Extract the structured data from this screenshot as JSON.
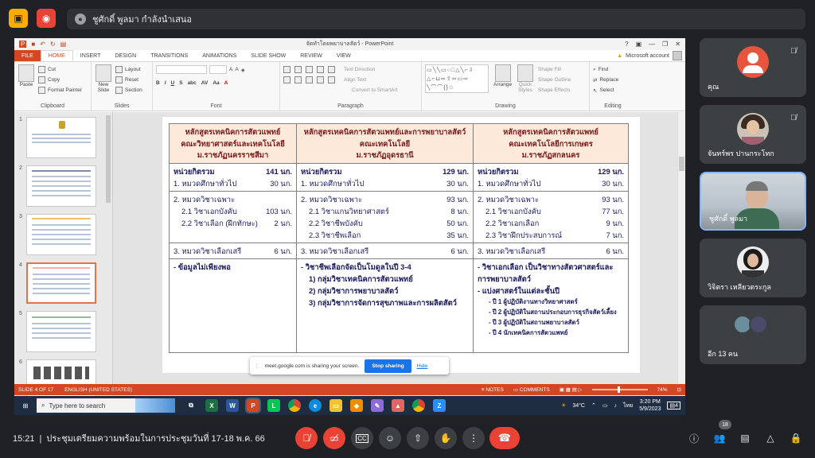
{
  "meet": {
    "presenter_name": "ชูศักดิ์ พูลมา กำลังนำเสนอ",
    "time": "15:21",
    "meeting_title": "ประชุมเตรียมความพร้อมในการประชุมวันที่ 17-18 พ.ค. 66",
    "participant_count": "18",
    "share_notice": "meet.google.com is sharing your screen.",
    "stop_sharing": "Stop sharing",
    "hide": "Hide",
    "participants": [
      {
        "name": "คุณ",
        "muted": true
      },
      {
        "name": "จันทร์พร ปานกระโทก",
        "muted": true
      },
      {
        "name": "ชูศักดิ์ พูลมา",
        "muted": false
      },
      {
        "name": "วิจิตรา เหลียวตระกูล",
        "muted": false
      },
      {
        "name": "อีก 13 คน",
        "muted": false
      }
    ],
    "colors": {
      "accent_red": "#ea4335",
      "tile_bg": "#3c4043",
      "blue": "#1a73e8"
    }
  },
  "ppt": {
    "window_title": "จัดทำโดยพยาบาลสัตว์ - PowerPoint",
    "tabs": [
      "FILE",
      "HOME",
      "INSERT",
      "DESIGN",
      "TRANSITIONS",
      "ANIMATIONS",
      "SLIDE SHOW",
      "REVIEW",
      "VIEW"
    ],
    "account": "Microsoft account",
    "ribbon": {
      "paste": "Paste",
      "cut": "Cut",
      "copy": "Copy",
      "format_painter": "Format Painter",
      "clipboard": "Clipboard",
      "new_slide": "New Slide",
      "layout": "Layout",
      "reset": "Reset",
      "section": "Section",
      "slides": "Slides",
      "font": "Font",
      "text_direction": "Text Direction",
      "align_text": "Align Text",
      "convert_smartart": "Convert to SmartArt",
      "paragraph": "Paragraph",
      "arrange": "Arrange",
      "quick_styles": "Quick Styles",
      "shape_fill": "Shape Fill",
      "shape_outline": "Shape Outline",
      "shape_effects": "Shape Effects",
      "drawing": "Drawing",
      "find": "Find",
      "replace": "Replace",
      "select": "Select",
      "editing": "Editing"
    },
    "thumb_numbers": [
      "1",
      "2",
      "3",
      "4",
      "5",
      "6"
    ],
    "status": {
      "slide": "SLIDE 4 OF 17",
      "language": "ENGLISH (UNITED STATES)",
      "notes": "NOTES",
      "comments": "COMMENTS",
      "zoom": "74%"
    },
    "slide": {
      "headers": [
        [
          "หลักสูตรเทคนิคการสัตวแพทย์",
          "คณะวิทยาศาสตร์และเทคโนโลยี",
          "ม.ราชภัฏนครราชสีมา"
        ],
        [
          "หลักสูตรเทคนิคการสัตวแพทย์และการพยาบาลสัตว์",
          "คณะเทคโนโลยี",
          "ม.ราชภัฏอุดรธานี"
        ],
        [
          "หลักสูตรเทคนิคการสัตวแพทย์",
          "คณะเทคโนโลยีการเกษตร",
          "ม.ราชภัฏสกลนคร"
        ]
      ],
      "total": [
        {
          "label": "หน่วยกิตรวม",
          "value": "141 นก."
        },
        {
          "label": "หน่วยกิตรวม",
          "value": "129 นก."
        },
        {
          "label": "หน่วยกิตรวม",
          "value": "129 นก."
        }
      ],
      "general": [
        {
          "label": "1. หมวดศึกษาทั่วไป",
          "value": "30 นก."
        },
        {
          "label": "1. หมวดศึกษาทั่วไป",
          "value": "30 นก."
        },
        {
          "label": "1. หมวดศึกษาทั่วไป",
          "value": "30 นก."
        }
      ],
      "specific": [
        [
          {
            "label": "2. หมวดวิชาเฉพาะ",
            "value": "",
            "indent": false
          },
          {
            "label": "2.1 วิชาเอกบังคับ",
            "value": "103 นก.",
            "indent": true
          },
          {
            "label": "2.2 วิชาเลือก (ฝึกทักษะ)",
            "value": "2 นก.",
            "indent": true
          }
        ],
        [
          {
            "label": "2. หมวดวิชาเฉพาะ",
            "value": "93 นก.",
            "indent": false
          },
          {
            "label": "2.1 วิชาแกนวิทยาศาสตร์",
            "value": "8 นก.",
            "indent": true
          },
          {
            "label": "2.2 วิชาชีพบังคับ",
            "value": "50 นก.",
            "indent": true
          },
          {
            "label": "2.3 วิชาชีพเลือก",
            "value": "35 นก.",
            "indent": true
          }
        ],
        [
          {
            "label": "2. หมวดวิชาเฉพาะ",
            "value": "93 นก.",
            "indent": false
          },
          {
            "label": "2.1 วิชาเอกบังคับ",
            "value": "77 นก.",
            "indent": true
          },
          {
            "label": "2.2 วิชาเอกเลือก",
            "value": "9 นก.",
            "indent": true
          },
          {
            "label": "2.3 วิชาฝึกประสบการณ์",
            "value": "7 นก.",
            "indent": true
          }
        ]
      ],
      "elective": [
        {
          "label": "3. หมวดวิชาเลือกเสรี",
          "value": "6 นก."
        },
        {
          "label": "3. หมวดวิชาเลือกเสรี",
          "value": "6 นก."
        },
        {
          "label": "3. หมวดวิชาเลือกเสรี",
          "value": "6 นก."
        }
      ],
      "notes": [
        [
          "- ข้อมูลไม่เพียงพอ"
        ],
        [
          "- วิชาชีพเลือกจัดเป็นโมดูลในปี 3-4",
          "1) กลุ่มวิชาเทคนิคการสัตวแพทย์",
          "2) กลุ่มวิชาการพยาบาลสัตว์",
          "3) กลุ่มวิชาการจัดการสุขภาพและการผลิตสัตว์"
        ],
        [
          "- วิชาเอกเลือก เป็นวิชาทางสัตวศาสตร์และ",
          "การพยาบาลสัตว์",
          "- แบ่งศาสตร์ในแต่ละชั้นปี",
          "- ปี 1 ผู้ปฏิบัติงานทางวิทยาศาสตร์",
          "- ปี 2 ผู้ปฏิบัติในสถานประกอบการธุรกิจสัตว์เลี้ยง",
          "- ปี 3 ผู้ปฏิบัติในสถานพยาบาลสัตว์",
          "- ปี 4 นักเทคนิคการสัตวแพทย์"
        ]
      ]
    }
  },
  "taskbar": {
    "search_placeholder": "Type here to search",
    "weather": "34°C",
    "lang": "ไทย",
    "clock_time": "3:20 PM",
    "clock_date": "5/9/2023",
    "notif_count": "4"
  }
}
